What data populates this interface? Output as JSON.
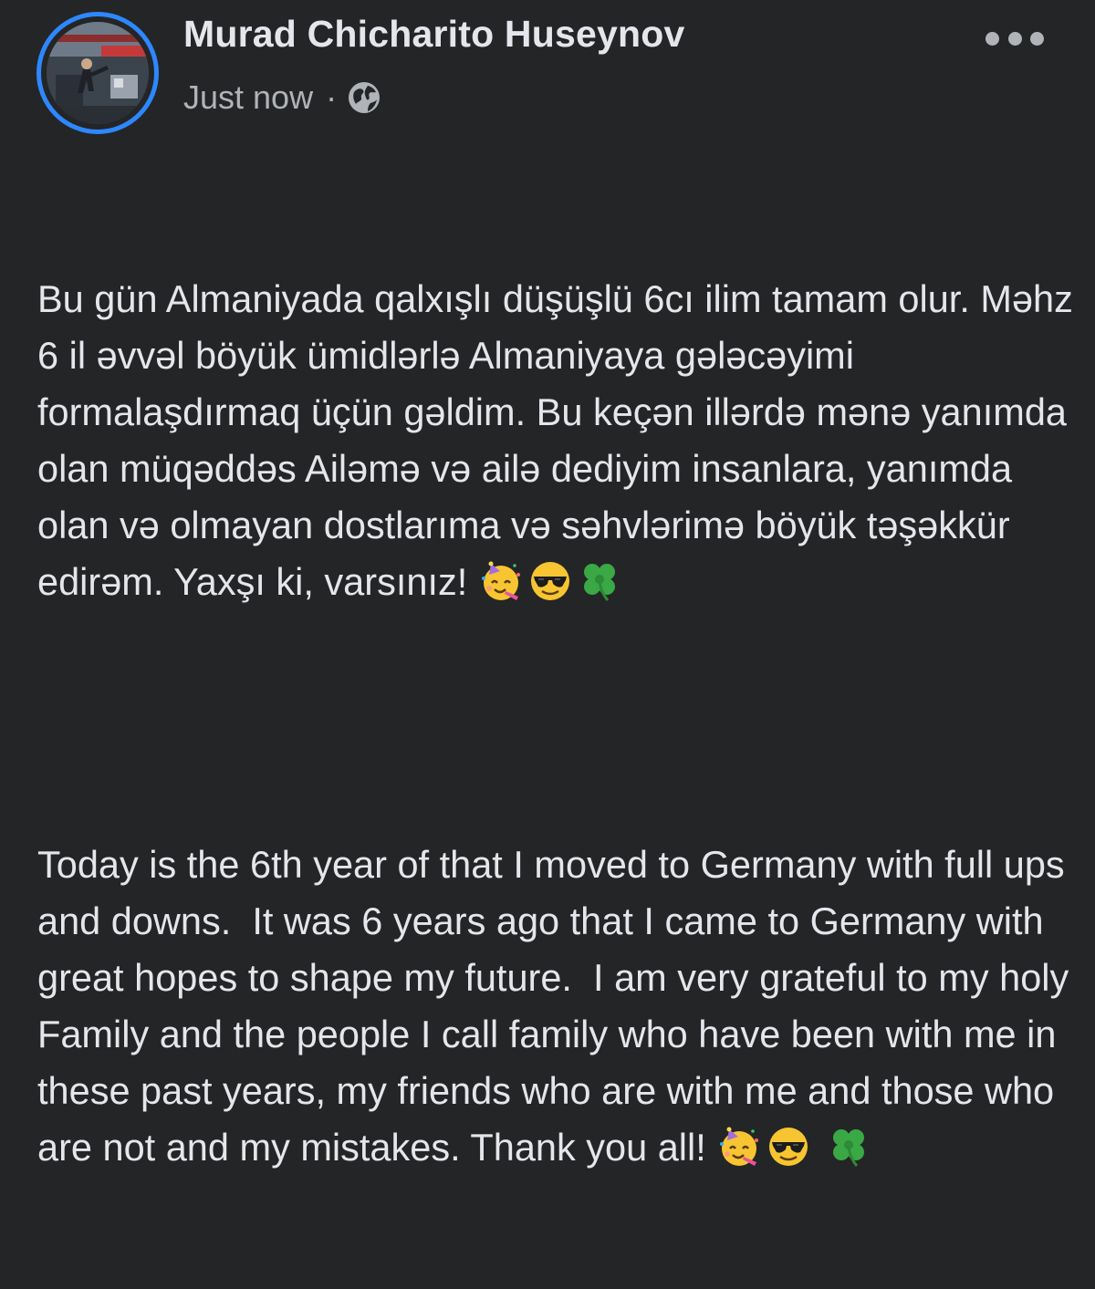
{
  "post": {
    "author": {
      "name": "Murad Chicharito Huseynov",
      "avatar_icon": "profile-photo"
    },
    "meta": {
      "time": "Just now",
      "separator": "·",
      "audience_icon": "globe-icon"
    },
    "menu_icon": "more-options-icon",
    "body": {
      "paragraph_az": "Bu gün Almaniyada qalxışlı düşüşlü 6cı ilim tamam olur. Məhz 6 il əvvəl böyük ümidlərlə Almaniyaya gələcəyimi formalaşdırmaq üçün gəldim. Bu keçən illərdə mənə yanımda olan müqəddəs Ailəmə və ailə dediyim insanlara, yanımda olan və olmayan dostlarıma və səhvlərimə böyük təşəkkür edirəm. Yaxşı ki, varsınız!",
      "paragraph_en": "Today is the 6th year of that I moved to Germany with full ups and downs.  It was 6 years ago that I came to Germany with great hopes to shape my future.  I am very grateful to my holy Family and the people I call family who have been with me in these past years, my friends who are with me and those who are not and my mistakes. Thank you all!",
      "emojis": [
        "partying-face",
        "smiling-face-with-sunglasses",
        "four-leaf-clover"
      ]
    }
  },
  "colors": {
    "background": "#242526",
    "text_primary": "#e4e6eb",
    "text_secondary": "#b0b3b8",
    "avatar_ring": "#2d88ff"
  }
}
